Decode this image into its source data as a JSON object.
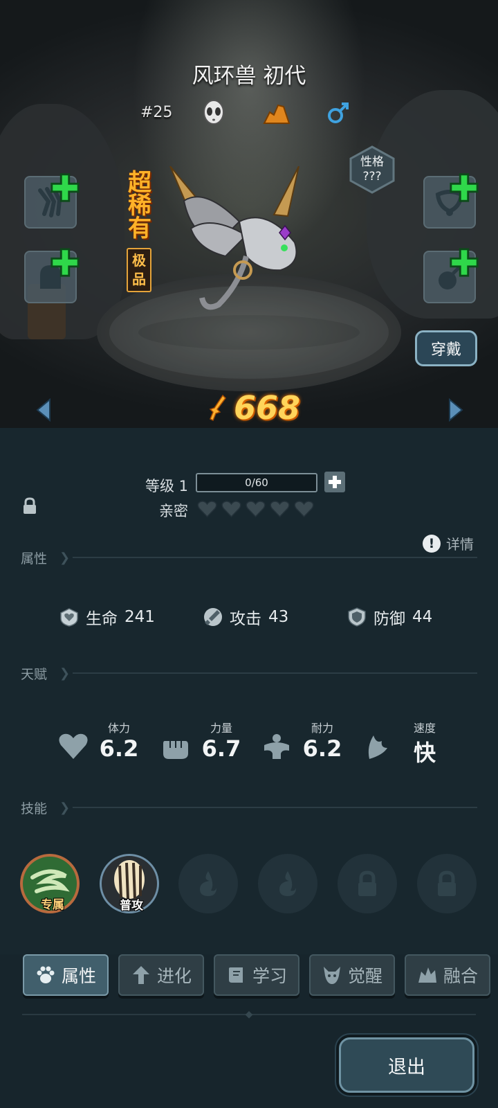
{
  "pet": {
    "name": "风环兽 初代",
    "id": "#25",
    "rarity": "超稀有",
    "grade": "极品",
    "personality_label": "性格",
    "personality_value": "???",
    "power": "668"
  },
  "buttons": {
    "wear": "穿戴",
    "exit": "退出"
  },
  "level": {
    "label": "等级 1",
    "exp": "0/60",
    "intimacy_label": "亲密",
    "hearts": 5
  },
  "detail_label": "详情",
  "sections": {
    "attributes": "属性",
    "talents": "天赋",
    "skills": "技能"
  },
  "stats": [
    {
      "icon": "heart-shield-icon",
      "label": "生命",
      "value": "241"
    },
    {
      "icon": "sword-icon",
      "label": "攻击",
      "value": "43"
    },
    {
      "icon": "shield-icon",
      "label": "防御",
      "value": "44"
    }
  ],
  "talents": [
    {
      "icon": "heart-icon",
      "label": "体力",
      "value": "6.2"
    },
    {
      "icon": "fist-icon",
      "label": "力量",
      "value": "6.7"
    },
    {
      "icon": "muscle-icon",
      "label": "耐力",
      "value": "6.2"
    },
    {
      "icon": "wing-icon",
      "label": "速度",
      "value": "快"
    }
  ],
  "skills": [
    {
      "label": "专属",
      "state": "equipped"
    },
    {
      "label": "普攻",
      "state": "equipped"
    },
    {
      "label": "",
      "state": "empty"
    },
    {
      "label": "",
      "state": "empty"
    },
    {
      "label": "",
      "state": "locked"
    },
    {
      "label": "",
      "state": "locked"
    }
  ],
  "tabs": [
    {
      "label": "属性",
      "icon": "paw-icon",
      "active": true
    },
    {
      "label": "进化",
      "icon": "evolve-arrow-icon",
      "active": false
    },
    {
      "label": "学习",
      "icon": "book-icon",
      "active": false
    },
    {
      "label": "觉醒",
      "icon": "demon-icon",
      "active": false
    },
    {
      "label": "融合",
      "icon": "fusion-icon",
      "active": false
    }
  ],
  "colors": {
    "power": "#ffd45a",
    "rarity": "#ffb228",
    "plus": "#2fd84a",
    "male": "#3fa2e0"
  }
}
